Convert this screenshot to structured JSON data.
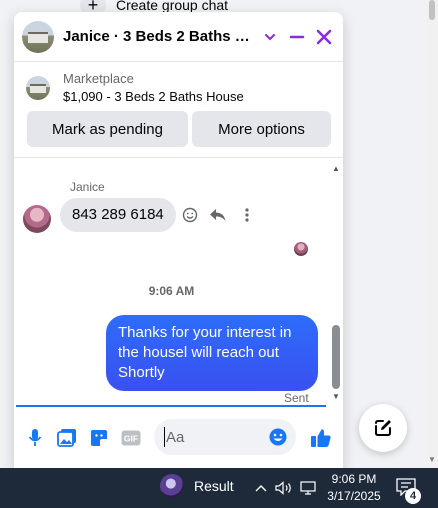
{
  "background": {
    "create_group_label": "Create group chat"
  },
  "chat": {
    "title": "Janice · 3 Beds 2 Baths House",
    "listing": {
      "source": "Marketplace",
      "item": "$1,090 - 3 Beds 2 Baths House"
    },
    "actions": {
      "mark_pending": "Mark as pending",
      "more_options": "More options"
    },
    "messages": {
      "sender_name": "Janice",
      "incoming_text": "843 289 6184",
      "timestamp": "9:06 AM",
      "outgoing_text": "Thanks for your interest in the housel will reach out Shortly",
      "status": "Sent"
    },
    "composer": {
      "placeholder": "Aa",
      "gif_label": "GIF"
    },
    "colors": {
      "accent": "#1877f2",
      "header_icons": "#8a2be2",
      "outgoing_bubble": "#3a5cf5"
    }
  },
  "taskbar": {
    "app_label": "Result",
    "time": "9:06 PM",
    "date": "3/17/2025",
    "notification_count": "4"
  }
}
